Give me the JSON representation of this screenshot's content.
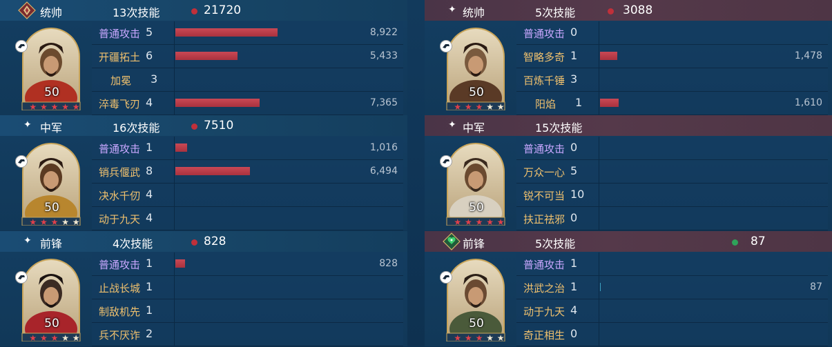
{
  "max_damage": 8922,
  "panels": [
    {
      "id": "left-commander",
      "role": "统帅",
      "skill_count": "13次技能",
      "total": "21720",
      "total_dot_color": "#c0303a",
      "level": "50",
      "stars": 5,
      "portrait_palette": [
        "#b03022",
        "#6b4a2e",
        "#2a1a12"
      ],
      "badge": "commander-badge-icon",
      "skills": [
        {
          "name": "普通攻击",
          "count": "5",
          "color": "purple",
          "damage": "8,922",
          "value": 8922
        },
        {
          "name": "开疆拓土",
          "count": "6",
          "color": "gold",
          "damage": "5,433",
          "value": 5433
        },
        {
          "name": "加冕",
          "count": "3",
          "color": "gold",
          "damage": "",
          "value": 0,
          "indent": true
        },
        {
          "name": "淬毒飞刃",
          "count": "4",
          "color": "gold",
          "damage": "7,365",
          "value": 7365
        }
      ]
    },
    {
      "id": "left-middle",
      "role": "中军",
      "skill_count": "16次技能",
      "total": "7510",
      "total_dot_color": "#c0303a",
      "level": "50",
      "stars": 3,
      "portrait_palette": [
        "#b8862e",
        "#5a3a22",
        "#2a1a12"
      ],
      "skills": [
        {
          "name": "普通攻击",
          "count": "1",
          "color": "purple",
          "damage": "1,016",
          "value": 1016
        },
        {
          "name": "销兵偃武",
          "count": "8",
          "color": "gold",
          "damage": "6,494",
          "value": 6494
        },
        {
          "name": "决水千仞",
          "count": "4",
          "color": "gold",
          "damage": "",
          "value": 0
        },
        {
          "name": "动于九天",
          "count": "4",
          "color": "gold",
          "damage": "",
          "value": 0
        }
      ]
    },
    {
      "id": "left-vanguard",
      "role": "前锋",
      "skill_count": "4次技能",
      "total": "828",
      "total_dot_color": "#c0303a",
      "level": "50",
      "stars": 3,
      "portrait_palette": [
        "#a8242a",
        "#3a2a22",
        "#1a1210"
      ],
      "skills": [
        {
          "name": "普通攻击",
          "count": "1",
          "color": "purple",
          "damage": "828",
          "value": 828
        },
        {
          "name": "止战长城",
          "count": "1",
          "color": "gold",
          "damage": "",
          "value": 0
        },
        {
          "name": "制敌机先",
          "count": "1",
          "color": "gold",
          "damage": "",
          "value": 0
        },
        {
          "name": "兵不厌诈",
          "count": "2",
          "color": "gold",
          "damage": "",
          "value": 0
        }
      ]
    },
    {
      "id": "right-commander",
      "role": "统帅",
      "skill_count": "5次技能",
      "total": "3088",
      "total_dot_color": "#c0303a",
      "level": "50",
      "stars": 3,
      "portrait_palette": [
        "#5a3a26",
        "#7a5a3e",
        "#2a1a12"
      ],
      "skills": [
        {
          "name": "普通攻击",
          "count": "0",
          "color": "purple",
          "damage": "",
          "value": 0
        },
        {
          "name": "智略多奇",
          "count": "1",
          "color": "gold",
          "damage": "1,478",
          "value": 1478
        },
        {
          "name": "百炼千锤",
          "count": "3",
          "color": "gold",
          "damage": "",
          "value": 0
        },
        {
          "name": "阳焰",
          "count": "1",
          "color": "gold",
          "damage": "1,610",
          "value": 1610,
          "indent": true
        }
      ]
    },
    {
      "id": "right-middle",
      "role": "中军",
      "skill_count": "15次技能",
      "total": "",
      "total_dot_color": "",
      "level": "50",
      "stars": 5,
      "portrait_palette": [
        "#d8d0c0",
        "#6a4a30",
        "#3a2a1e"
      ],
      "skills": [
        {
          "name": "普通攻击",
          "count": "0",
          "color": "purple",
          "damage": "",
          "value": 0
        },
        {
          "name": "万众一心",
          "count": "5",
          "color": "gold",
          "damage": "",
          "value": 0
        },
        {
          "name": "锐不可当",
          "count": "10",
          "color": "gold",
          "damage": "",
          "value": 0
        },
        {
          "name": "扶正祛邪",
          "count": "0",
          "color": "gold",
          "damage": "",
          "value": 0
        }
      ]
    },
    {
      "id": "right-vanguard",
      "role": "前锋",
      "skill_count": "5次技能",
      "total": "87",
      "total_dot_color": "#2fa35a",
      "level": "50",
      "stars": 3,
      "portrait_palette": [
        "#4a5a3a",
        "#6a4a32",
        "#2a1e16"
      ],
      "badge": "heal-badge-icon",
      "skills": [
        {
          "name": "普通攻击",
          "count": "1",
          "color": "purple",
          "damage": "",
          "value": 0
        },
        {
          "name": "洪武之治",
          "count": "1",
          "color": "gold",
          "damage": "87",
          "value": 87,
          "thin": true
        },
        {
          "name": "动于九天",
          "count": "4",
          "color": "gold",
          "damage": "",
          "value": 0
        },
        {
          "name": "奇正相生",
          "count": "0",
          "color": "gold",
          "damage": "",
          "value": 0
        }
      ]
    }
  ]
}
